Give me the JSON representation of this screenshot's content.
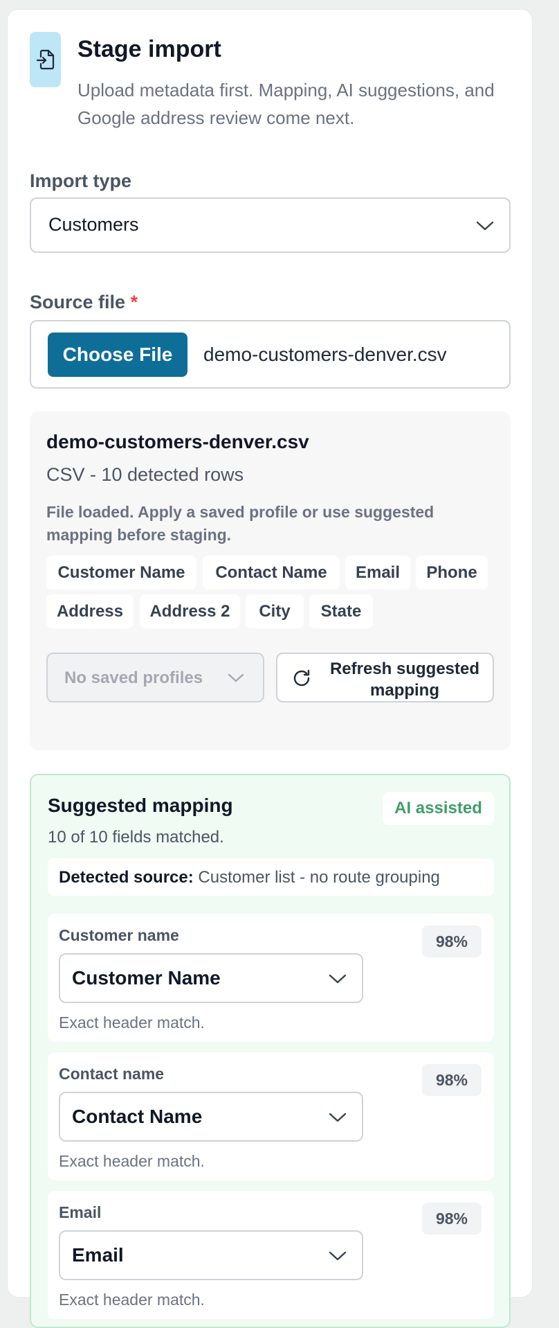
{
  "header": {
    "icon": "file-import-icon",
    "title": "Stage import",
    "subtitle": "Upload metadata first. Mapping, AI suggestions, and Google address review come next."
  },
  "import_type": {
    "label": "Import type",
    "value": "Customers"
  },
  "source_file": {
    "label": "Source file",
    "required_mark": "*",
    "button_label": "Choose File",
    "file_name": "demo-customers-denver.csv"
  },
  "file_panel": {
    "name": "demo-customers-denver.csv",
    "meta": "CSV - 10 detected rows",
    "note": "File loaded. Apply a saved profile or use suggested mapping before staging.",
    "columns": [
      "Customer Name",
      "Contact Name",
      "Email",
      "Phone",
      "Address",
      "Address 2",
      "City",
      "State"
    ],
    "profile_placeholder": "No saved profiles",
    "refresh_label": "Refresh suggested mapping"
  },
  "mapping": {
    "title": "Suggested mapping",
    "badge": "AI assisted",
    "count": "10 of 10 fields matched.",
    "detected_label": "Detected source:",
    "detected_value": "Customer list - no route grouping",
    "fields": [
      {
        "label": "Customer name",
        "value": "Customer Name",
        "confidence": "98%",
        "note": "Exact header match."
      },
      {
        "label": "Contact name",
        "value": "Contact Name",
        "confidence": "98%",
        "note": "Exact header match."
      },
      {
        "label": "Email",
        "value": "Email",
        "confidence": "98%",
        "note": "Exact header match."
      }
    ]
  },
  "colors": {
    "primary": "#0e6e98",
    "icon_bg": "#bde6f7",
    "required": "#ef4444",
    "ai_green": "#3f9e6a",
    "mapping_bg": "#effbf3",
    "mapping_border": "#bfe8cd"
  }
}
